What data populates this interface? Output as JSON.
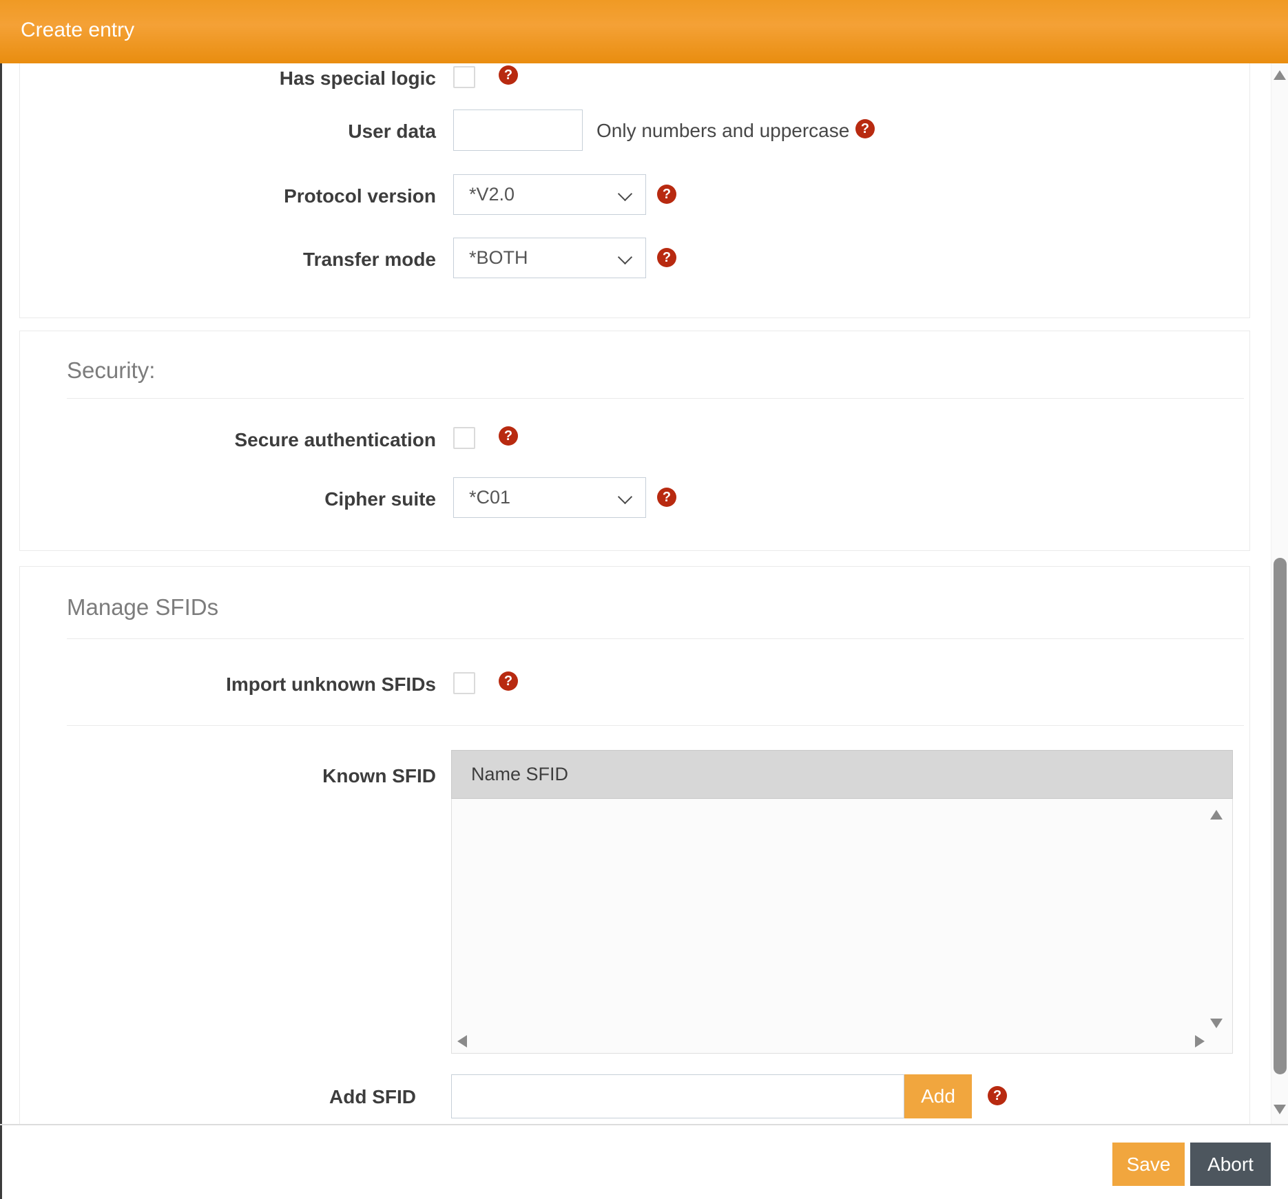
{
  "header": {
    "title": "Create entry"
  },
  "general": {
    "rows": [
      {
        "label": "Has special logic",
        "type": "checkbox",
        "checked": false
      },
      {
        "label": "User data",
        "type": "text",
        "value": "",
        "hint": "Only numbers and uppercase"
      },
      {
        "label": "Protocol version",
        "type": "select",
        "value": "*V2.0"
      },
      {
        "label": "Transfer mode",
        "type": "select",
        "value": "*BOTH"
      }
    ]
  },
  "security": {
    "heading": "Security:",
    "rows": [
      {
        "label": "Secure authentication",
        "type": "checkbox",
        "checked": false
      },
      {
        "label": "Cipher suite",
        "type": "select",
        "value": "*C01"
      }
    ]
  },
  "sfids": {
    "heading": "Manage SFIDs",
    "import_label": "Import unknown SFIDs",
    "import_checked": false,
    "known_label": "Known SFID",
    "list_header": "Name SFID",
    "list_rows": [],
    "add_label": "Add SFID",
    "add_value": "",
    "add_button_label": "Add"
  },
  "footer": {
    "save_label": "Save",
    "abort_label": "Abort"
  },
  "icons": {
    "help_glyph": "?"
  },
  "colors": {
    "accent_orange": "#f1a63e",
    "header_top": "#f4a136",
    "header_bottom": "#e98d0f",
    "help_red": "#b82a10",
    "abort_gray": "#4d565e"
  }
}
